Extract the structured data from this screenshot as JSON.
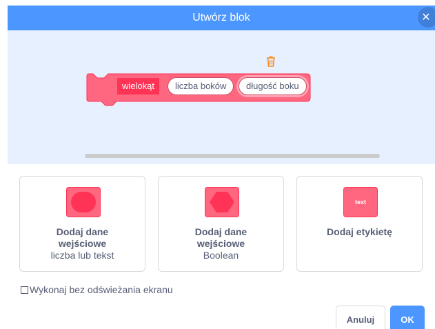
{
  "dialog": {
    "title": "Utwórz blok",
    "close_icon": "close-x-icon"
  },
  "block": {
    "label": "wielokąt",
    "inputs": [
      {
        "text": "liczba boków",
        "selected": false
      },
      {
        "text": "długość boku",
        "selected": true
      }
    ],
    "trash_icon": "trash-icon"
  },
  "options": [
    {
      "title_line1": "Dodaj dane",
      "title_line2": "wejściowe",
      "subtitle": "liczba lub tekst",
      "icon": "round-input-icon"
    },
    {
      "title_line1": "Dodaj dane",
      "title_line2": "wejściowe",
      "subtitle": "Boolean",
      "icon": "boolean-input-icon"
    },
    {
      "title_line1": "Dodaj etykietę",
      "title_line2": "",
      "subtitle": "",
      "icon": "text-label-icon",
      "icon_text": "text"
    }
  ],
  "run_without_refresh": {
    "label": "Wykonaj bez odświeżania ekranu",
    "checked": false
  },
  "buttons": {
    "cancel": "Anuluj",
    "ok": "OK"
  },
  "colors": {
    "title_bar": "#4c97ff",
    "workspace": "#e6f0ff",
    "block_fill": "#ff6680",
    "block_label": "#ff3355",
    "trash": "#ff8c1a",
    "text": "#575e75"
  }
}
